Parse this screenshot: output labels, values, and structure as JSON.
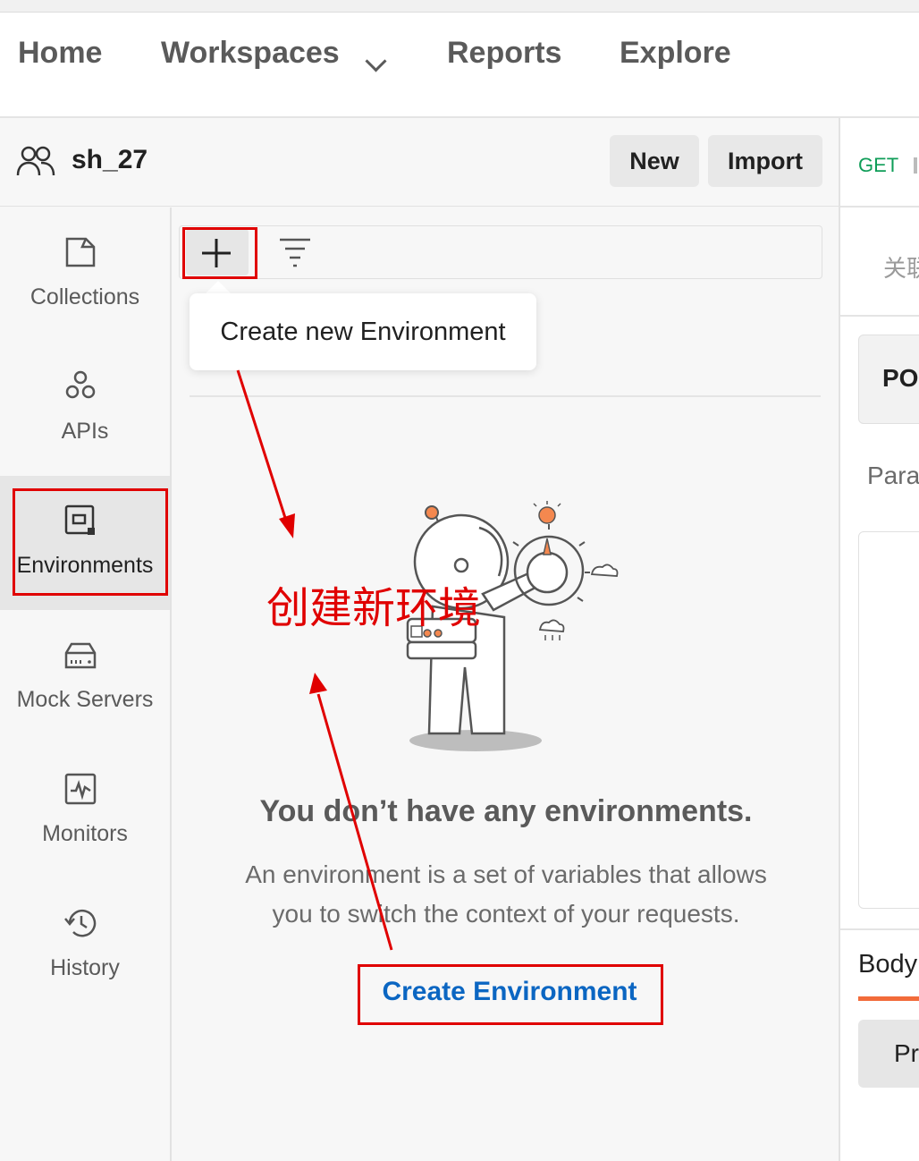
{
  "nav": {
    "items": [
      {
        "label": "Home"
      },
      {
        "label": "Workspaces"
      },
      {
        "label": "Reports"
      },
      {
        "label": "Explore"
      }
    ]
  },
  "workspace": {
    "name": "sh_27",
    "new_label": "New",
    "import_label": "Import"
  },
  "sidebar": {
    "items": [
      {
        "label": "Collections",
        "icon": "collections-icon"
      },
      {
        "label": "APIs",
        "icon": "apis-icon"
      },
      {
        "label": "Environments",
        "icon": "environments-icon",
        "active": true
      },
      {
        "label": "Mock Servers",
        "icon": "mock-servers-icon"
      },
      {
        "label": "Monitors",
        "icon": "monitors-icon"
      },
      {
        "label": "History",
        "icon": "history-icon"
      }
    ]
  },
  "env_panel": {
    "tooltip": "Create new Environment",
    "empty_title": "You don’t have any environments.",
    "empty_desc_line1": "An environment is a set of variables that allows",
    "empty_desc_line2": "you to switch the context of your requests.",
    "create_link": "Create Environment"
  },
  "annotation": {
    "text": "创建新环境",
    "color": "#e00000"
  },
  "right_pane": {
    "method": "GET",
    "method_color": "#0f9d58",
    "tab_partial": "关联",
    "method_select_partial": "PO",
    "params_partial": "Para",
    "body_tab_partial": "Body",
    "pretty_partial": "Pr"
  },
  "colors": {
    "accent": "#0b66c2",
    "active_tab_underline": "#f26b3a",
    "astronaut_orange": "#f4884f"
  }
}
